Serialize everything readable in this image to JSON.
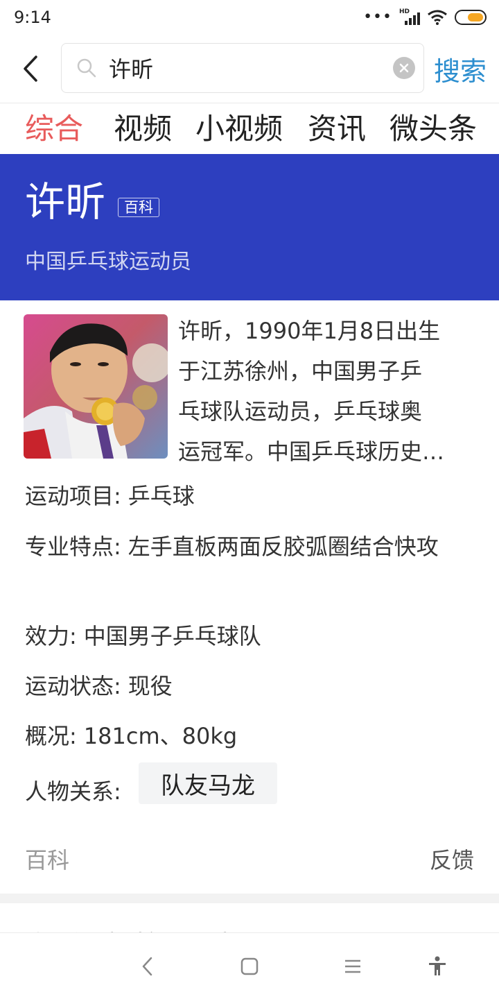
{
  "status_bar": {
    "time": "9:14",
    "dots": "•••",
    "hd": "HD",
    "battery_level": 0.62,
    "battery_color": "#f5a623"
  },
  "search": {
    "query": "许昕",
    "button_label": "搜索",
    "icons": {
      "back": "back-chevron-icon",
      "search": "search-icon",
      "clear": "clear-icon"
    }
  },
  "tabs": [
    {
      "label": "综合",
      "active": true
    },
    {
      "label": "视频",
      "active": false
    },
    {
      "label": "小视频",
      "active": false
    },
    {
      "label": "资讯",
      "active": false
    },
    {
      "label": "微头条",
      "active": false
    }
  ],
  "colors": {
    "hero_background": "#2d3fbf",
    "active_tab": "#e85b5b",
    "search_button": "#2c8ecf"
  },
  "hero": {
    "title": "许昕",
    "badge": "百科",
    "subtitle": "中国乒乓球运动员"
  },
  "summary_lines": [
    "许昕，1990年1月8日出生",
    "于江苏徐州，中国男子乒",
    "乓球队运动员，乒乓球奥",
    "运冠军。中国乒乓球历史…"
  ],
  "info": {
    "sport": {
      "label": "运动项目:",
      "value": "乒乓球"
    },
    "specialty": {
      "label": "专业特点:",
      "value": "左手直板两面反胶弧圈结合快攻"
    },
    "team": {
      "label": "效力:",
      "value": "中国男子乒乓球队"
    },
    "status": {
      "label": "运动状态:",
      "value": "现役"
    },
    "overview": {
      "label": "概况:",
      "value": "181cm、80kg"
    },
    "relations": {
      "label": "人物关系:",
      "chip": "队友马龙"
    }
  },
  "card_footer": {
    "source": "百科",
    "feedback": "反馈"
  },
  "next_peek": "许昕 被 拉 朋 友",
  "nav": {
    "icons": [
      "nav-back-icon",
      "nav-home-icon",
      "nav-menu-icon",
      "accessibility-icon"
    ]
  }
}
